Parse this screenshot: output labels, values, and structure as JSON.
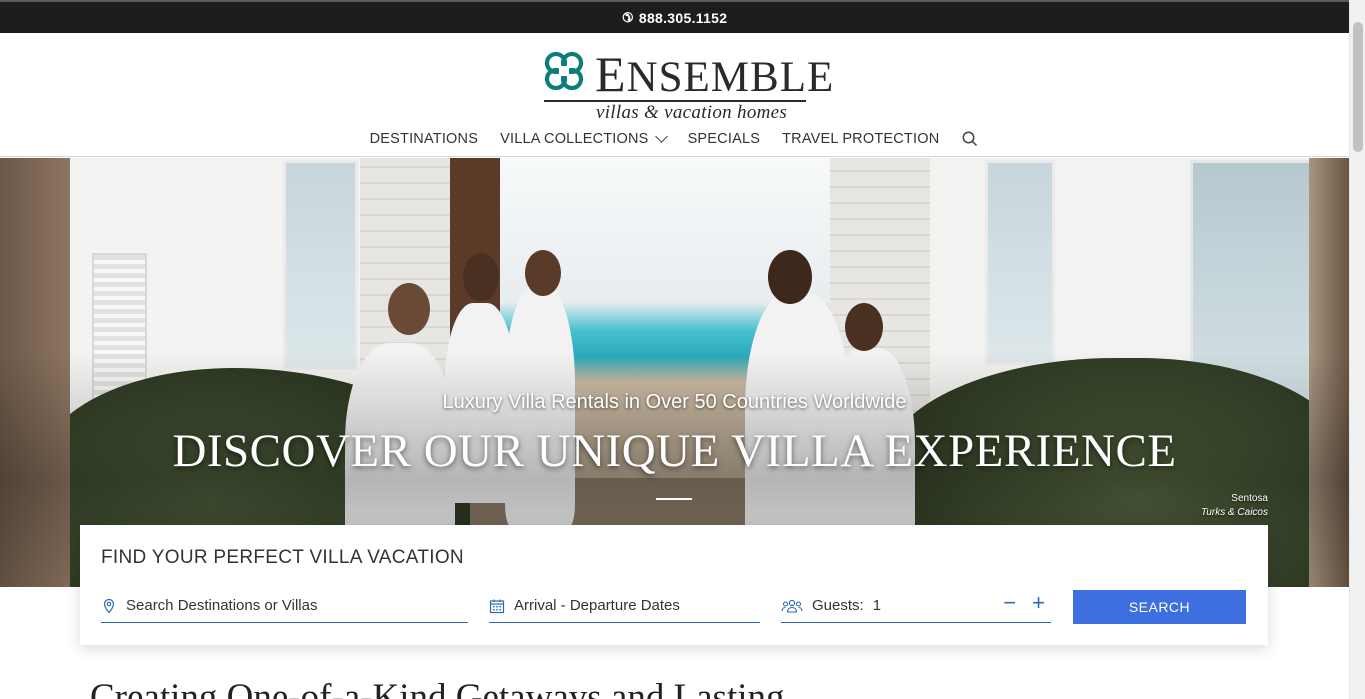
{
  "topbar": {
    "phone": "888.305.1152",
    "icon": "phone-icon"
  },
  "brand": {
    "name_first": "E",
    "name_rest": "NSEMBLE",
    "tagline": "villas & vacation homes",
    "accent": "#0e7c7b"
  },
  "nav": {
    "items": [
      {
        "label": "DESTINATIONS"
      },
      {
        "label": "VILLA COLLECTIONS",
        "has_dropdown": true
      },
      {
        "label": "SPECIALS"
      },
      {
        "label": "TRAVEL PROTECTION"
      }
    ],
    "search_icon": "search-icon"
  },
  "hero": {
    "subtitle": "Luxury Villa Rentals in Over 50 Countries Worldwide",
    "title": "DISCOVER OUR UNIQUE VILLA EXPERIENCE",
    "caption_name": "Sentosa",
    "caption_location": "Turks & Caicos"
  },
  "search": {
    "title": "FIND YOUR PERFECT VILLA VACATION",
    "destination_placeholder": "Search Destinations or Villas",
    "dates_placeholder": "Arrival - Departure Dates",
    "guests_label": "Guests:",
    "guests_value": "1",
    "minus": "−",
    "plus": "+",
    "button": "SEARCH",
    "accent": "#3d6fe0"
  },
  "intro": {
    "heading_partial": "Creating One-of-a-Kind Getaways and Lasting"
  }
}
